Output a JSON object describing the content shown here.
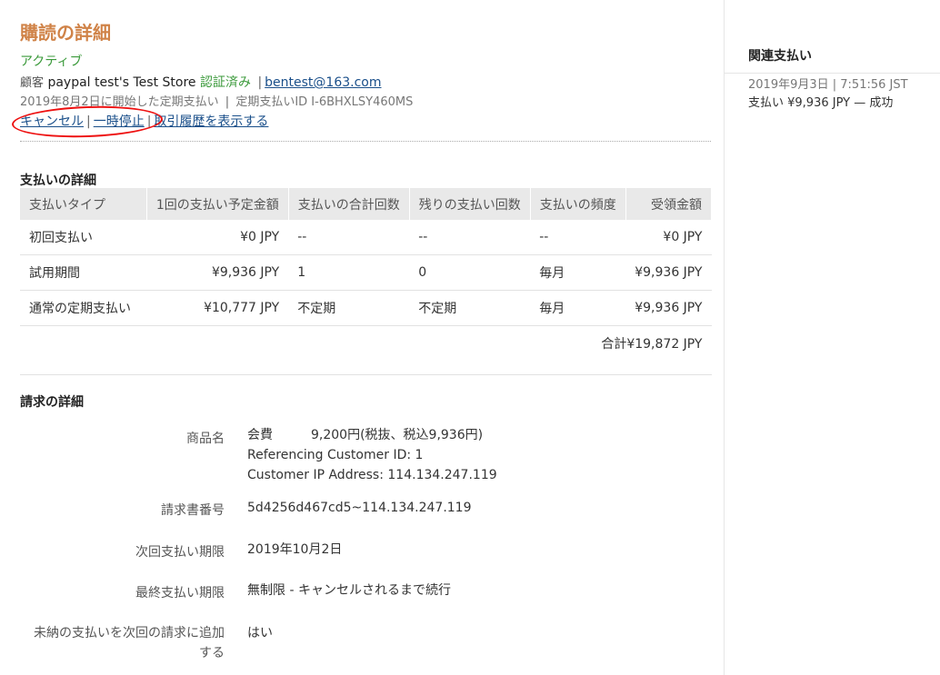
{
  "header": {
    "title": "購読の詳細",
    "status": "アクティブ",
    "customer_label": "顧客",
    "store_name": "paypal test's Test Store",
    "verified": "認証済み",
    "email": "bentest@163.com",
    "started": "2019年8月2日に開始した定期支払い",
    "profile_id": "定期支払いID I-6BHXLSY460MS"
  },
  "actions": {
    "cancel": "キャンセル",
    "pause": "一時停止",
    "history": "取引履歴を表示する"
  },
  "payment_details": {
    "title": "支払いの詳細",
    "columns": [
      "支払いタイプ",
      "1回の支払い予定金額",
      "支払いの合計回数",
      "残りの支払い回数",
      "支払いの頻度",
      "受領金額"
    ],
    "rows": [
      [
        "初回支払い",
        "¥0 JPY",
        "--",
        "--",
        "--",
        "¥0 JPY"
      ],
      [
        "試用期間",
        "¥9,936 JPY",
        "1",
        "0",
        "毎月",
        "¥9,936 JPY"
      ],
      [
        "通常の定期支払い",
        "¥10,777 JPY",
        "不定期",
        "不定期",
        "毎月",
        "¥9,936 JPY"
      ]
    ],
    "total": "合計¥19,872 JPY"
  },
  "billing": {
    "title": "請求の詳細",
    "product_label": "商品名",
    "product_line1": "会費　　　9,200円(税抜、税込9,936円)",
    "product_line2": "Referencing Customer ID: 1",
    "product_line3": "Customer IP Address: 114.134.247.119",
    "invoice_label": "請求書番号",
    "invoice_value": "5d4256d467cd5~114.134.247.119",
    "next_due_label": "次回支払い期限",
    "next_due_value": "2019年10月2日",
    "final_due_label": "最終支払い期限",
    "final_due_value": "無制限 - キャンセルされるまで続行",
    "add_unpaid_label_1": "未納の支払いを次回の請求に追加",
    "add_unpaid_label_2": "する",
    "add_unpaid_value": "はい"
  },
  "sidebar": {
    "title": "関連支払い",
    "date": "2019年9月3日 | 7:51:56 JST",
    "payment": "支払い ¥9,936 JPY — 成功"
  }
}
